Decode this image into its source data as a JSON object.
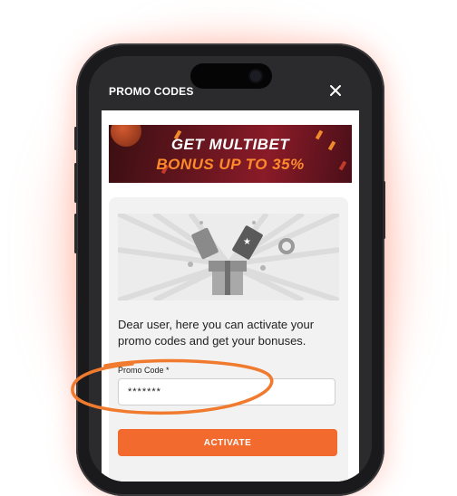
{
  "header": {
    "title": "PROMO CODES"
  },
  "banner": {
    "line1": "GET MULTIBET",
    "line2": "BONUS UP TO 35%"
  },
  "card": {
    "description": "Dear user, here you can activate your promo codes and get your bonuses.",
    "promo_label": "Promo Code *",
    "promo_value": "*******",
    "activate_label": "ACTIVATE"
  },
  "colors": {
    "accent": "#f26a2e",
    "banner_bg": "#6a1620",
    "banner_highlight": "#ff8a2a",
    "highlight_circle": "#f07a2e"
  },
  "icons": {
    "close": "close-icon",
    "illustration": "gift-box-illustration"
  }
}
